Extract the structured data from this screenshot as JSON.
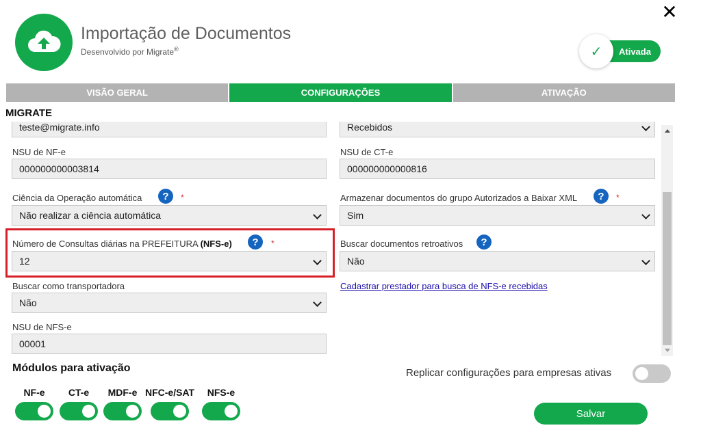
{
  "header": {
    "title": "Importação de Documentos",
    "subtitle": "Desenvolvido por Migrate",
    "subtitle_mark": "®",
    "status_label": "Ativada",
    "close_glyph": "✕"
  },
  "tabs": [
    {
      "label": "VISÃO GERAL",
      "active": false
    },
    {
      "label": "CONFIGURAÇÕES",
      "active": true
    },
    {
      "label": "ATIVAÇÃO",
      "active": false
    }
  ],
  "section_title": "MIGRATE",
  "form": {
    "email_value": "teste@migrate.info",
    "tipo_value": "Recebidos",
    "nsu_nfe_label": "NSU de NF-e",
    "nsu_nfe_value": "000000000003814",
    "nsu_cte_label": "NSU de CT-e",
    "nsu_cte_value": "000000000000816",
    "ciencia_label": "Ciência da Operação automática",
    "ciencia_value": "Não realizar a ciência automática",
    "armazenar_label": "Armazenar documentos do grupo Autorizados a Baixar XML",
    "armazenar_value": "Sim",
    "consultas_label": "Número de Consultas diárias na PREFEITURA",
    "consultas_label_bold": "(NFS-e)",
    "consultas_value": "12",
    "retroativos_label": "Buscar documentos retroativos",
    "retroativos_value": "Não",
    "cadastrar_link": "Cadastrar prestador para busca de NFS-e recebidas",
    "transportadora_label": "Buscar como transportadora",
    "transportadora_value": "Não",
    "nsu_nfse_label": "NSU de NFS-e",
    "nsu_nfse_value": "00001",
    "required_mark": "*",
    "help_glyph": "?"
  },
  "modules": {
    "title": "Módulos para ativação",
    "items": [
      {
        "label": "NF-e",
        "enabled": true
      },
      {
        "label": "CT-e",
        "enabled": true
      },
      {
        "label": "MDF-e",
        "enabled": true
      },
      {
        "label": "NFC-e/SAT",
        "enabled": true
      },
      {
        "label": "NFS-e",
        "enabled": true
      }
    ]
  },
  "replicate": {
    "label": "Replicar configurações para empresas ativas",
    "enabled": false
  },
  "save_label": "Salvar",
  "colors": {
    "brand_green": "#12a84b",
    "tab_inactive": "#b3b3b3",
    "help_blue": "#1565c0",
    "highlight_red": "#d61f26"
  }
}
